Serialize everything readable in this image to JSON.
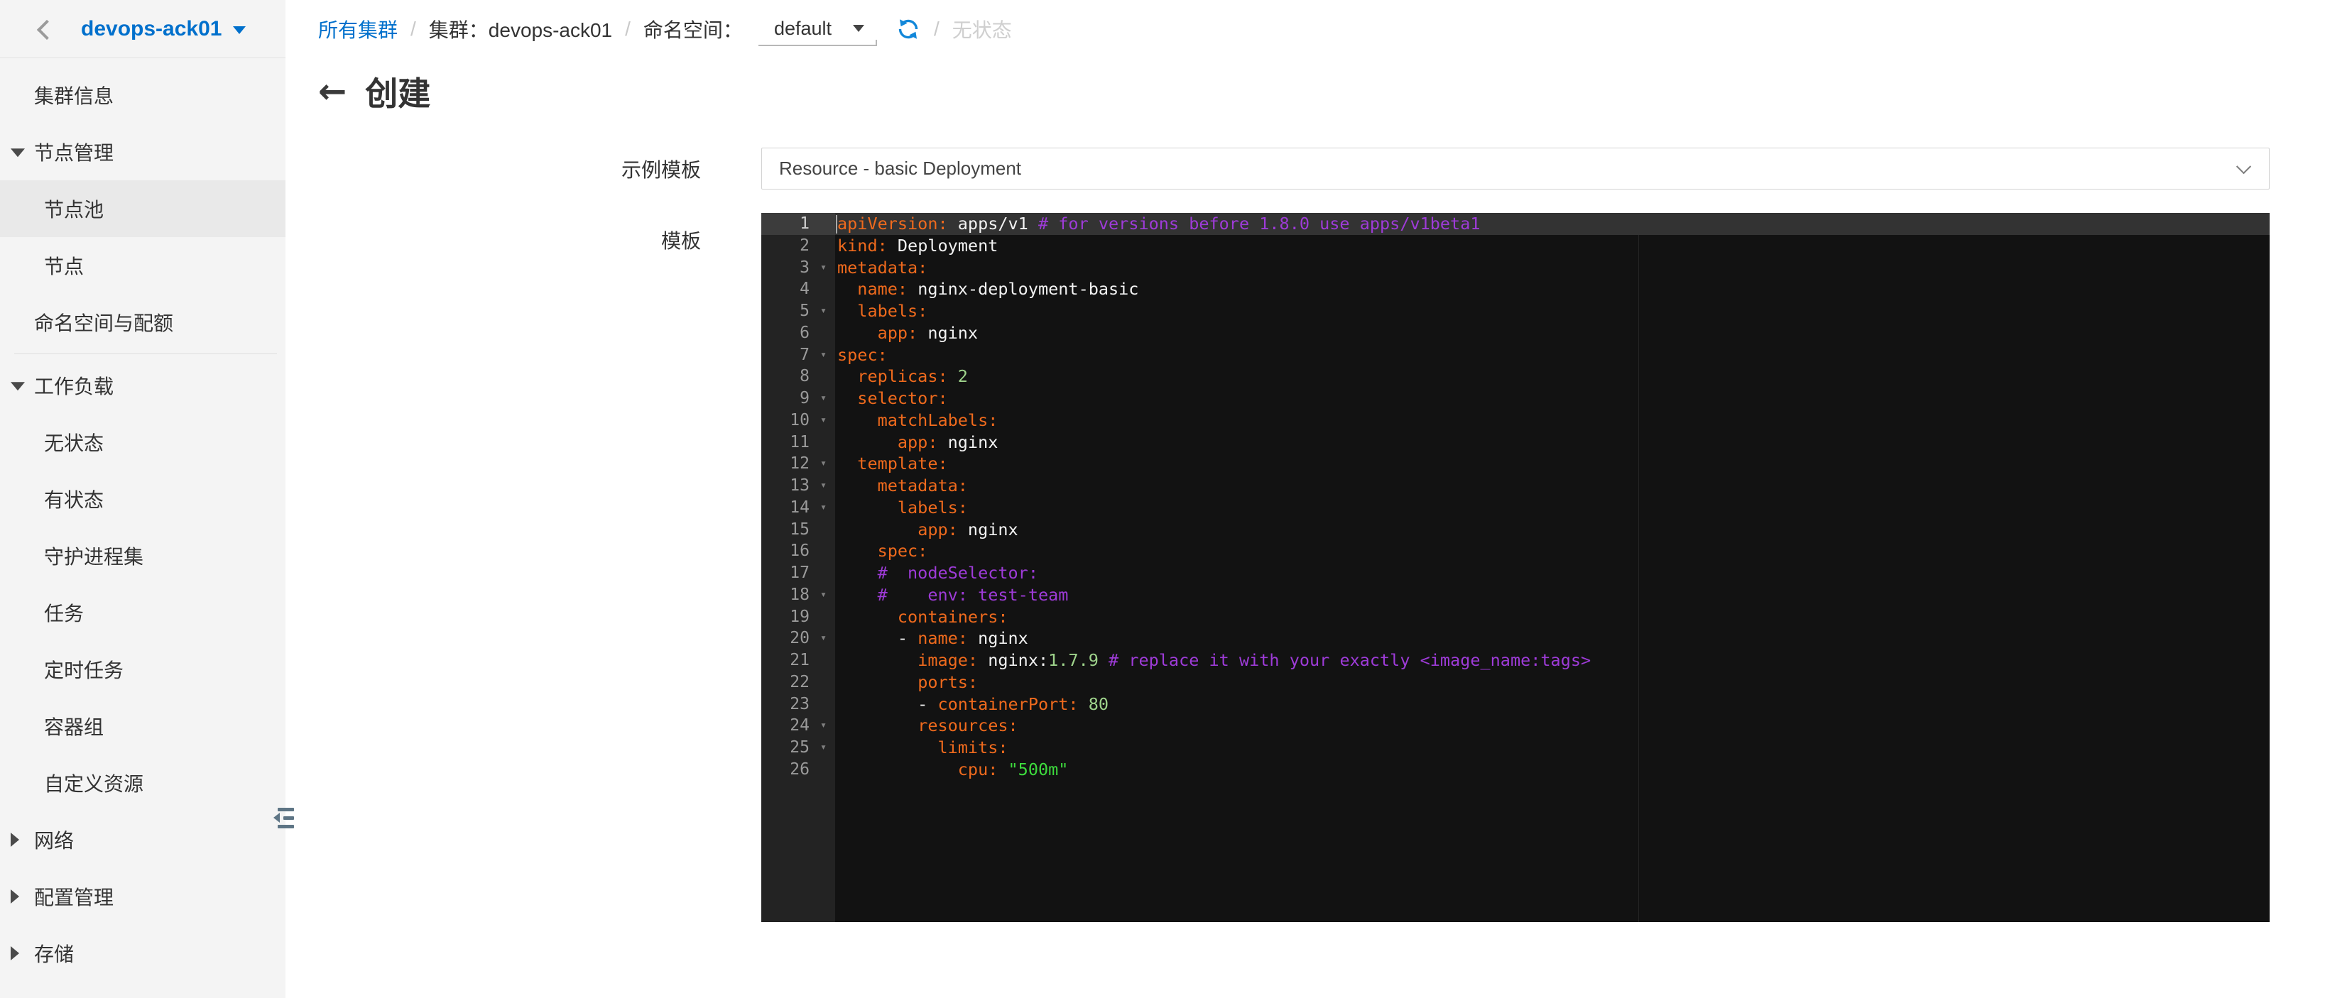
{
  "colors": {
    "accent_blue": "#0070cc",
    "refresh_blue": "#1287d9",
    "sidebar_bg": "#f4f4f4",
    "sidebar_selected_bg": "#e9e9e9"
  },
  "icons": {
    "back_arrow": "←",
    "fold_marker": "▾"
  },
  "sidebar": {
    "cluster_name": "devops-ack01",
    "items": [
      {
        "name": "cluster-info",
        "label": "集群信息",
        "type": "top"
      },
      {
        "name": "node-management",
        "label": "节点管理",
        "type": "section",
        "state": "expanded"
      },
      {
        "name": "node-pools",
        "label": "节点池",
        "type": "child",
        "selected": true
      },
      {
        "name": "nodes",
        "label": "节点",
        "type": "child"
      },
      {
        "name": "namespaces-quotas",
        "label": "命名空间与配额",
        "type": "top",
        "divider_after": true
      },
      {
        "name": "workloads",
        "label": "工作负载",
        "type": "section",
        "state": "expanded"
      },
      {
        "name": "deployments",
        "label": "无状态",
        "type": "child"
      },
      {
        "name": "statefulsets",
        "label": "有状态",
        "type": "child"
      },
      {
        "name": "daemonsets",
        "label": "守护进程集",
        "type": "child"
      },
      {
        "name": "jobs",
        "label": "任务",
        "type": "child"
      },
      {
        "name": "cronjobs",
        "label": "定时任务",
        "type": "child"
      },
      {
        "name": "pods",
        "label": "容器组",
        "type": "child"
      },
      {
        "name": "custom-resources",
        "label": "自定义资源",
        "type": "child"
      },
      {
        "name": "network",
        "label": "网络",
        "type": "section",
        "state": "collapsed"
      },
      {
        "name": "configuration",
        "label": "配置管理",
        "type": "section",
        "state": "collapsed"
      },
      {
        "name": "storage",
        "label": "存储",
        "type": "section",
        "state": "collapsed"
      }
    ]
  },
  "breadcrumb": {
    "all_clusters": "所有集群",
    "cluster": "集群：devops-ack01",
    "namespace_label": "命名空间：",
    "namespace_value": "default",
    "separator": "/",
    "tail": "无状态"
  },
  "page": {
    "title": "创建"
  },
  "form": {
    "sample_template_label": "示例模板",
    "sample_template_value": "Resource - basic Deployment",
    "template_label": "模板"
  },
  "editor": {
    "active_line": 1,
    "fold_lines": [
      3,
      5,
      7,
      9,
      10,
      12,
      13,
      14,
      18,
      20,
      24,
      25
    ],
    "colors": {
      "key": "#ef6a1d",
      "plain": "#f2f2f2",
      "comment": "#9e3bd8",
      "number": "#9fd48c",
      "string": "#3ddb3d"
    },
    "lines": [
      [
        {
          "t": "apiVersion:",
          "c": "key"
        },
        {
          "t": " apps/v1 ",
          "c": "plain"
        },
        {
          "t": "# for versions before 1.8.0 use apps/v1beta1",
          "c": "comment"
        }
      ],
      [
        {
          "t": "kind:",
          "c": "key"
        },
        {
          "t": " Deployment",
          "c": "plain"
        }
      ],
      [
        {
          "t": "metadata:",
          "c": "key"
        }
      ],
      [
        {
          "t": "  ",
          "c": "plain"
        },
        {
          "t": "name:",
          "c": "key"
        },
        {
          "t": " nginx-deployment-basic",
          "c": "plain"
        }
      ],
      [
        {
          "t": "  ",
          "c": "plain"
        },
        {
          "t": "labels:",
          "c": "key"
        }
      ],
      [
        {
          "t": "    ",
          "c": "plain"
        },
        {
          "t": "app:",
          "c": "key"
        },
        {
          "t": " nginx",
          "c": "plain"
        }
      ],
      [
        {
          "t": "spec:",
          "c": "key"
        }
      ],
      [
        {
          "t": "  ",
          "c": "plain"
        },
        {
          "t": "replicas:",
          "c": "key"
        },
        {
          "t": " ",
          "c": "plain"
        },
        {
          "t": "2",
          "c": "number"
        }
      ],
      [
        {
          "t": "  ",
          "c": "plain"
        },
        {
          "t": "selector:",
          "c": "key"
        }
      ],
      [
        {
          "t": "    ",
          "c": "plain"
        },
        {
          "t": "matchLabels:",
          "c": "key"
        }
      ],
      [
        {
          "t": "      ",
          "c": "plain"
        },
        {
          "t": "app:",
          "c": "key"
        },
        {
          "t": " nginx",
          "c": "plain"
        }
      ],
      [
        {
          "t": "  ",
          "c": "plain"
        },
        {
          "t": "template:",
          "c": "key"
        }
      ],
      [
        {
          "t": "    ",
          "c": "plain"
        },
        {
          "t": "metadata:",
          "c": "key"
        }
      ],
      [
        {
          "t": "      ",
          "c": "plain"
        },
        {
          "t": "labels:",
          "c": "key"
        }
      ],
      [
        {
          "t": "        ",
          "c": "plain"
        },
        {
          "t": "app:",
          "c": "key"
        },
        {
          "t": " nginx",
          "c": "plain"
        }
      ],
      [
        {
          "t": "    ",
          "c": "plain"
        },
        {
          "t": "spec:",
          "c": "key"
        }
      ],
      [
        {
          "t": "    ",
          "c": "plain"
        },
        {
          "t": "#  nodeSelector:",
          "c": "comment"
        }
      ],
      [
        {
          "t": "    ",
          "c": "plain"
        },
        {
          "t": "#    env: test-team",
          "c": "comment"
        }
      ],
      [
        {
          "t": "      ",
          "c": "plain"
        },
        {
          "t": "containers:",
          "c": "key"
        }
      ],
      [
        {
          "t": "      - ",
          "c": "plain"
        },
        {
          "t": "name:",
          "c": "key"
        },
        {
          "t": " nginx",
          "c": "plain"
        }
      ],
      [
        {
          "t": "        ",
          "c": "plain"
        },
        {
          "t": "image:",
          "c": "key"
        },
        {
          "t": " nginx:",
          "c": "plain"
        },
        {
          "t": "1.7.9",
          "c": "number"
        },
        {
          "t": " ",
          "c": "plain"
        },
        {
          "t": "# replace it with your exactly <image_name:tags>",
          "c": "comment"
        }
      ],
      [
        {
          "t": "        ",
          "c": "plain"
        },
        {
          "t": "ports:",
          "c": "key"
        }
      ],
      [
        {
          "t": "        - ",
          "c": "plain"
        },
        {
          "t": "containerPort:",
          "c": "key"
        },
        {
          "t": " ",
          "c": "plain"
        },
        {
          "t": "80",
          "c": "number"
        }
      ],
      [
        {
          "t": "        ",
          "c": "plain"
        },
        {
          "t": "resources:",
          "c": "key"
        }
      ],
      [
        {
          "t": "          ",
          "c": "plain"
        },
        {
          "t": "limits:",
          "c": "key"
        }
      ],
      [
        {
          "t": "            ",
          "c": "plain"
        },
        {
          "t": "cpu:",
          "c": "key"
        },
        {
          "t": " ",
          "c": "plain"
        },
        {
          "t": "\"500m\"",
          "c": "string"
        }
      ]
    ]
  }
}
